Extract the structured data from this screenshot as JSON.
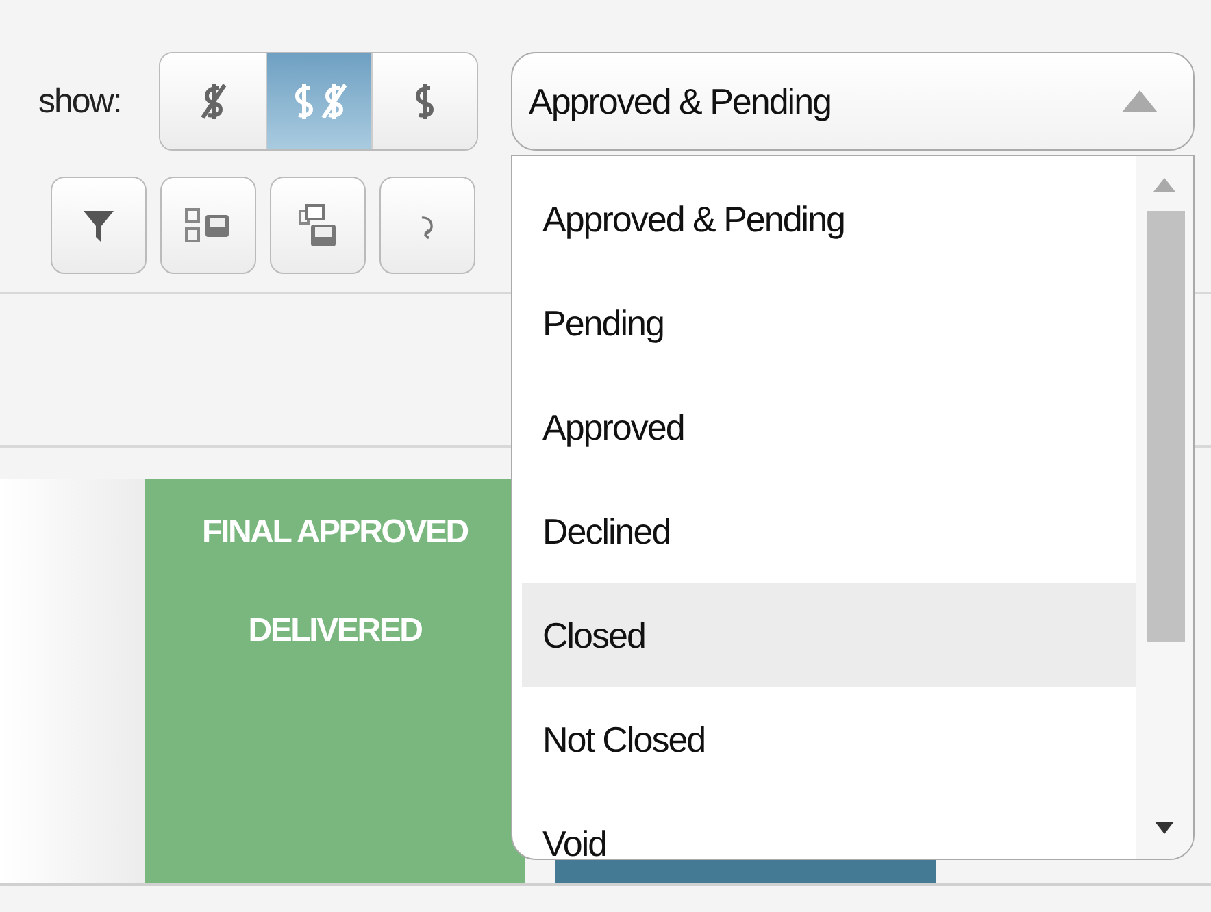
{
  "show_label": "show:",
  "view_toggle": [
    {
      "kind": "no-dollar",
      "selected": false
    },
    {
      "kind": "both",
      "selected": true
    },
    {
      "kind": "dollar",
      "selected": false
    }
  ],
  "tools": [
    {
      "kind": "filter"
    },
    {
      "kind": "group"
    },
    {
      "kind": "stack"
    },
    {
      "kind": "refresh"
    }
  ],
  "status_select": {
    "value": "Approved & Pending",
    "expanded": true,
    "options": [
      {
        "label": "Approved & Pending",
        "highlighted": false
      },
      {
        "label": "Pending",
        "highlighted": false
      },
      {
        "label": "Approved",
        "highlighted": false
      },
      {
        "label": "Declined",
        "highlighted": false
      },
      {
        "label": "Closed",
        "highlighted": true
      },
      {
        "label": "Not Closed",
        "highlighted": false
      },
      {
        "label": "Void",
        "highlighted": false
      }
    ]
  },
  "card": {
    "lines": [
      "FINAL APPROVED",
      "DELIVERED"
    ],
    "color": "#79b77f"
  }
}
